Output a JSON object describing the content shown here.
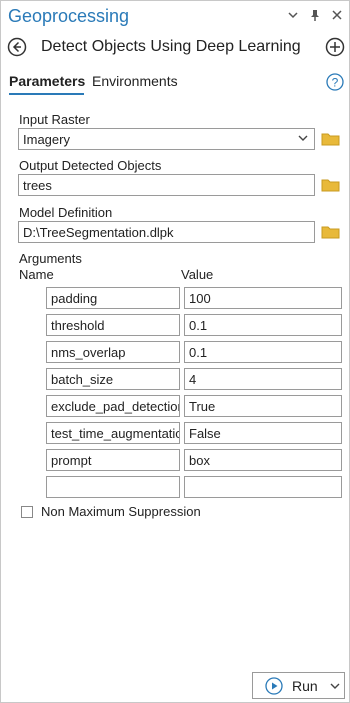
{
  "pane": {
    "title": "Geoprocessing",
    "icons": [
      "chevron-down-icon",
      "pin-icon",
      "close-icon"
    ]
  },
  "tool": {
    "title": "Detect Objects Using Deep Learning"
  },
  "tabs": {
    "parameters": "Parameters",
    "environments": "Environments"
  },
  "form": {
    "input_raster_label": "Input Raster",
    "input_raster_value": "Imagery",
    "output_label": "Output Detected Objects",
    "output_value": "trees",
    "model_label": "Model Definition",
    "model_value": "D:\\TreeSegmentation.dlpk",
    "arguments_label": "Arguments",
    "name_header": "Name",
    "value_header": "Value",
    "arguments": [
      {
        "name": "padding",
        "value": "100"
      },
      {
        "name": "threshold",
        "value": "0.1"
      },
      {
        "name": "nms_overlap",
        "value": "0.1"
      },
      {
        "name": "batch_size",
        "value": "4"
      },
      {
        "name": "exclude_pad_detections",
        "value": "True"
      },
      {
        "name": "test_time_augmentation",
        "value": "False"
      },
      {
        "name": "prompt",
        "value": "box"
      },
      {
        "name": "",
        "value": ""
      }
    ],
    "nms_label": "Non Maximum Suppression"
  },
  "run": {
    "label": "Run"
  },
  "colors": {
    "accent": "#2a7ab8",
    "folder": "#e8b93a"
  }
}
